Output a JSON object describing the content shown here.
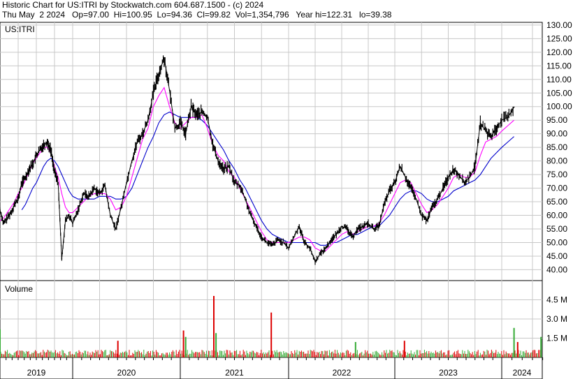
{
  "header": {
    "line1": "Historic Chart for US:ITRI by Stockwatch.com 604.687.1500 - (c) 2024",
    "line2": "Thu May  2 2024   Op=97.00  Hi=100.95  Lo=94.36  Cl=99.82  Vol=1,354,796   Year hi=122.31   lo=39.38"
  },
  "colors": {
    "price": "#000000",
    "ma_short": "#ff00ff",
    "ma_long": "#0000cc",
    "volume_up": "#33aa33",
    "volume_down": "#dd0000",
    "grid": "#c8c8c8"
  },
  "chart_data": [
    {
      "type": "line",
      "symbol_label": "US:ITRI",
      "y_ticks": [
        "130.00",
        "125.00",
        "120.00",
        "115.00",
        "110.00",
        "105.00",
        "100.00",
        "95.00",
        "90.00",
        "85.00",
        "80.00",
        "75.00",
        "70.00",
        "65.00",
        "60.00",
        "55.00",
        "50.00",
        "45.00",
        "40.00"
      ],
      "ylim": [
        36,
        131
      ],
      "x_ticks": [
        "2019",
        "2020",
        "2021",
        "2022",
        "2023",
        "2024"
      ],
      "x": [
        2019.0,
        2019.05,
        2019.1,
        2019.15,
        2019.2,
        2019.25,
        2019.3,
        2019.35,
        2019.4,
        2019.45,
        2019.5,
        2019.55,
        2019.6,
        2019.65,
        2019.7,
        2019.75,
        2019.8,
        2019.85,
        2019.9,
        2019.95,
        2020.0,
        2020.05,
        2020.1,
        2020.15,
        2020.2,
        2020.25,
        2020.3,
        2020.35,
        2020.4,
        2020.45,
        2020.5,
        2020.55,
        2020.6,
        2020.65,
        2020.7,
        2020.75,
        2020.8,
        2020.85,
        2020.9,
        2020.95,
        2021.0,
        2021.05,
        2021.1,
        2021.15,
        2021.2,
        2021.25,
        2021.3,
        2021.35,
        2021.4,
        2021.45,
        2021.5,
        2021.55,
        2021.6,
        2021.65,
        2021.7,
        2021.75,
        2021.8,
        2021.85,
        2021.9,
        2021.95,
        2022.0,
        2022.05,
        2022.1,
        2022.15,
        2022.2,
        2022.25,
        2022.3,
        2022.35,
        2022.4,
        2022.45,
        2022.5,
        2022.55,
        2022.6,
        2022.65,
        2022.7,
        2022.75,
        2022.8,
        2022.85,
        2022.9,
        2022.95,
        2023.0,
        2023.05,
        2023.1,
        2023.15,
        2023.2,
        2023.25,
        2023.3,
        2023.35,
        2023.4,
        2023.45,
        2023.5,
        2023.55,
        2023.6,
        2023.65,
        2023.7,
        2023.75,
        2023.8,
        2023.85,
        2023.9,
        2023.95,
        2024.0,
        2024.05,
        2024.1,
        2024.15,
        2024.2,
        2024.25,
        2024.3,
        2024.33
      ],
      "series": [
        {
          "values": [
            62,
            57,
            59,
            61,
            64,
            66,
            72,
            74,
            77,
            79,
            82,
            84,
            86,
            87,
            84,
            76,
            72,
            44,
            58,
            60,
            57,
            62,
            68,
            67,
            70,
            68,
            71,
            60,
            55,
            63,
            72,
            80,
            87,
            90,
            95,
            105,
            112,
            118,
            106,
            92,
            94,
            90,
            100,
            97,
            98,
            96,
            86,
            80,
            77,
            78,
            72,
            71,
            66,
            60,
            56,
            52,
            50,
            49,
            51,
            50,
            48,
            52,
            56,
            50,
            48,
            43,
            46,
            48,
            51,
            53,
            56,
            55,
            52,
            55,
            56,
            57,
            55,
            56,
            64,
            69,
            72,
            78,
            74,
            70,
            66,
            60,
            58,
            63,
            66,
            70,
            74,
            77,
            75,
            72,
            74,
            78,
            94,
            91,
            89,
            92,
            95,
            96,
            99.82
          ]
        },
        {
          "values": [
            58,
            59,
            61,
            63,
            65,
            68,
            70,
            73,
            76,
            79,
            81,
            83,
            85,
            85,
            83,
            78,
            74,
            68,
            63,
            61,
            61,
            63,
            65,
            67,
            68,
            68,
            68,
            66,
            62,
            63,
            67,
            74,
            81,
            88,
            92,
            100,
            104,
            107,
            100,
            94,
            92,
            94,
            96,
            96,
            97,
            92,
            86,
            82,
            80,
            76,
            74,
            70,
            66,
            62,
            58,
            54,
            51,
            50,
            50,
            50,
            50,
            51,
            52,
            52,
            51,
            48,
            47,
            47,
            49,
            51,
            53,
            54,
            53,
            54,
            55,
            56,
            56,
            57,
            60,
            64,
            68,
            72,
            73,
            72,
            68,
            64,
            61,
            62,
            64,
            67,
            70,
            74,
            75,
            74,
            74,
            76,
            82,
            87,
            88,
            89,
            91,
            93,
            95
          ]
        },
        {
          "values": [
            null,
            null,
            null,
            null,
            null,
            null,
            62,
            64,
            67,
            70,
            72,
            75,
            78,
            80,
            81,
            80,
            78,
            75,
            72,
            69,
            67,
            66,
            66,
            66,
            66,
            67,
            67,
            67,
            66,
            66,
            67,
            70,
            75,
            80,
            85,
            89,
            94,
            97,
            98,
            97,
            96,
            96,
            96,
            96,
            95,
            93,
            90,
            87,
            84,
            80,
            77,
            73,
            70,
            66,
            62,
            58,
            55,
            53,
            52,
            51,
            50,
            50,
            50,
            50,
            50,
            50,
            49,
            49,
            50,
            50,
            51,
            52,
            53,
            53,
            54,
            55,
            56,
            56,
            58,
            60,
            63,
            66,
            68,
            69,
            69,
            68,
            66,
            65,
            65,
            66,
            67,
            69,
            70,
            71,
            72,
            73,
            75,
            78,
            81,
            83,
            85,
            87,
            89
          ]
        }
      ]
    },
    {
      "type": "bar",
      "title": "Volume",
      "y_ticks": [
        "4.5 M",
        "3.0 M",
        "1.5 M"
      ],
      "ylim": [
        0,
        6.0
      ],
      "x_ticks": [
        "2019",
        "2020",
        "2021",
        "2022",
        "2023",
        "2024"
      ],
      "spikes": [
        {
          "x": 2019.0,
          "value": 2.2,
          "up": true
        },
        {
          "x": 2020.42,
          "value": 1.3,
          "up": false
        },
        {
          "x": 2021.03,
          "value": 2.1,
          "up": false
        },
        {
          "x": 2021.05,
          "value": 1.6,
          "up": true
        },
        {
          "x": 2021.31,
          "value": 4.8,
          "up": false
        },
        {
          "x": 2021.33,
          "value": 1.9,
          "up": true
        },
        {
          "x": 2021.84,
          "value": 3.5,
          "up": false
        },
        {
          "x": 2022.63,
          "value": 1.2,
          "up": true
        },
        {
          "x": 2023.09,
          "value": 1.3,
          "up": false
        },
        {
          "x": 2024.1,
          "value": 2.3,
          "up": true
        },
        {
          "x": 2024.13,
          "value": 1.2,
          "up": false
        },
        {
          "x": 2024.32,
          "value": 1.6,
          "up": true
        }
      ]
    }
  ]
}
